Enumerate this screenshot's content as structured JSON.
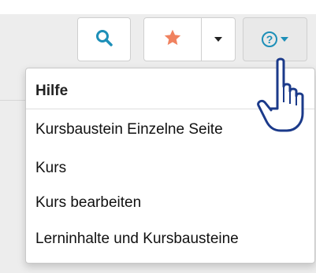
{
  "colors": {
    "accent": "#1d8fb8",
    "star": "#f0825f"
  },
  "icons": {
    "search": "search-icon",
    "star": "star-icon",
    "caret": "caret-down-icon",
    "help": "help-circle-icon",
    "cursor": "hand-pointer-cursor"
  },
  "help_glyph": "?",
  "menu": {
    "header": "Hilfe",
    "items": [
      "Kursbaustein Einzelne Seite",
      "Kurs",
      "Kurs bearbeiten",
      "Lerninhalte und Kursbausteine"
    ]
  }
}
